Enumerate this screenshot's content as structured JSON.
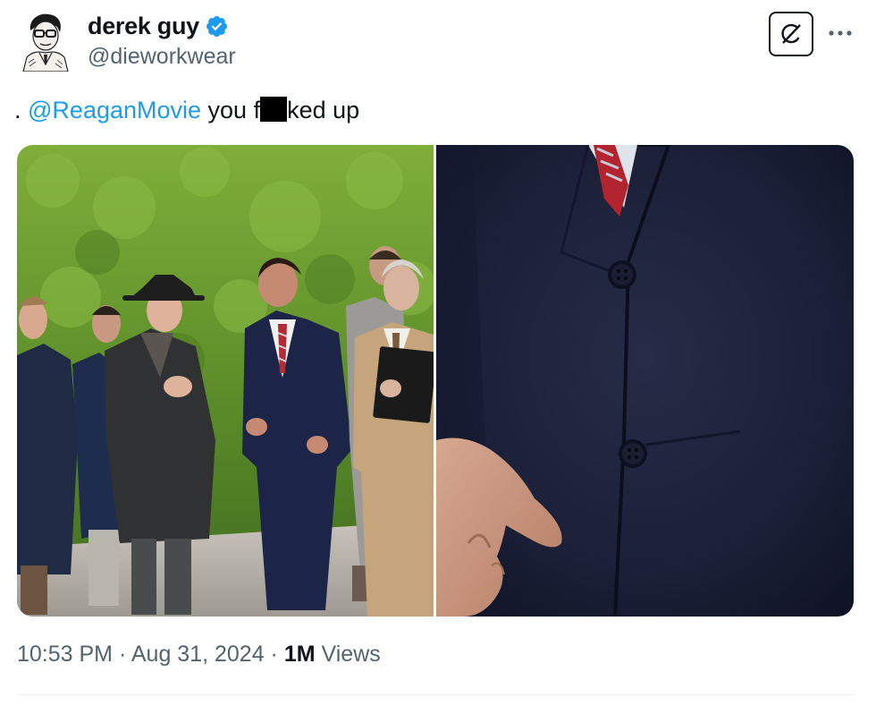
{
  "author": {
    "display_name": "derek guy",
    "handle": "@dieworkwear",
    "verified": true,
    "avatar_icon": "sketch-portrait-avatar"
  },
  "header_actions": {
    "grok_icon": "grok-icon",
    "more_icon": "more-dots-icon"
  },
  "tweet": {
    "prefix": ". ",
    "mention": "@ReaganMovie",
    "text_before_redaction": " you f",
    "text_after_redaction": "ked up"
  },
  "media": [
    {
      "description_icon": "photo-men-walking"
    },
    {
      "description_icon": "photo-jacket-closeup"
    }
  ],
  "meta": {
    "time": "10:53 PM",
    "separator": " · ",
    "date": "Aug 31, 2024",
    "views_count": "1M",
    "views_label": " Views"
  },
  "colors": {
    "accent": "#1d9bf0",
    "text_primary": "#0f1419",
    "text_secondary": "#536471"
  }
}
